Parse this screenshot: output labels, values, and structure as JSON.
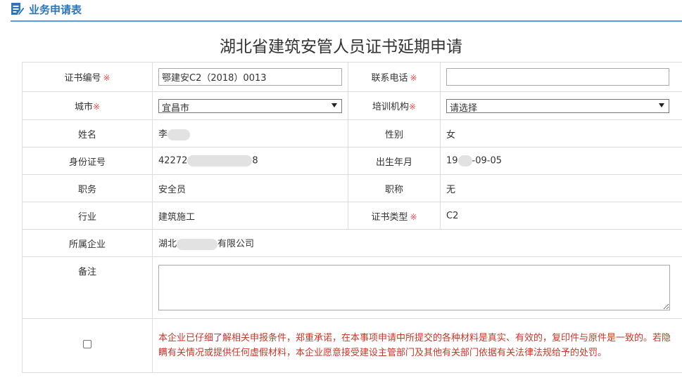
{
  "header": {
    "title": "业务申请表",
    "icon": "edit-form-icon",
    "accent": "#2e75b6"
  },
  "page_title": "湖北省建筑安管人员证书延期申请",
  "required_mark": "※",
  "rows": {
    "cert_no": {
      "label": "证书编号",
      "value": "鄂建安C2（2018）0013"
    },
    "phone": {
      "label": "联系电话",
      "value": ""
    },
    "city": {
      "label": "城市",
      "selected": "宜昌市"
    },
    "training": {
      "label": "培训机构",
      "selected": "请选择"
    },
    "name": {
      "label": "姓名",
      "value_prefix": "李"
    },
    "gender": {
      "label": "性别",
      "value": "女"
    },
    "id_no": {
      "label": "身份证号",
      "value_prefix": "42272",
      "value_suffix": "8"
    },
    "birth": {
      "label": "出生年月",
      "value_prefix": "19",
      "value_suffix": "-09-05"
    },
    "duty": {
      "label": "职务",
      "value": "安全员"
    },
    "title": {
      "label": "职称",
      "value": "无"
    },
    "industry": {
      "label": "行业",
      "value": "建筑施工"
    },
    "cert_type": {
      "label": "证书类型",
      "value": "C2"
    },
    "company": {
      "label": "所属企业",
      "value_prefix": "湖北",
      "value_suffix": "有限公司"
    },
    "remark": {
      "label": "备注",
      "value": ""
    }
  },
  "agreement": {
    "checked": false,
    "text": "本企业已仔细了解相关申报条件，郑重承诺，在本事项申请中所提交的各种材料是真实、有效的，复印件与原件是一致的。若隐瞒有关情况或提供任何虚假材料，本企业愿意接受建设主管部门及其他有关部门依据有关法律法规给予的处罚。"
  }
}
